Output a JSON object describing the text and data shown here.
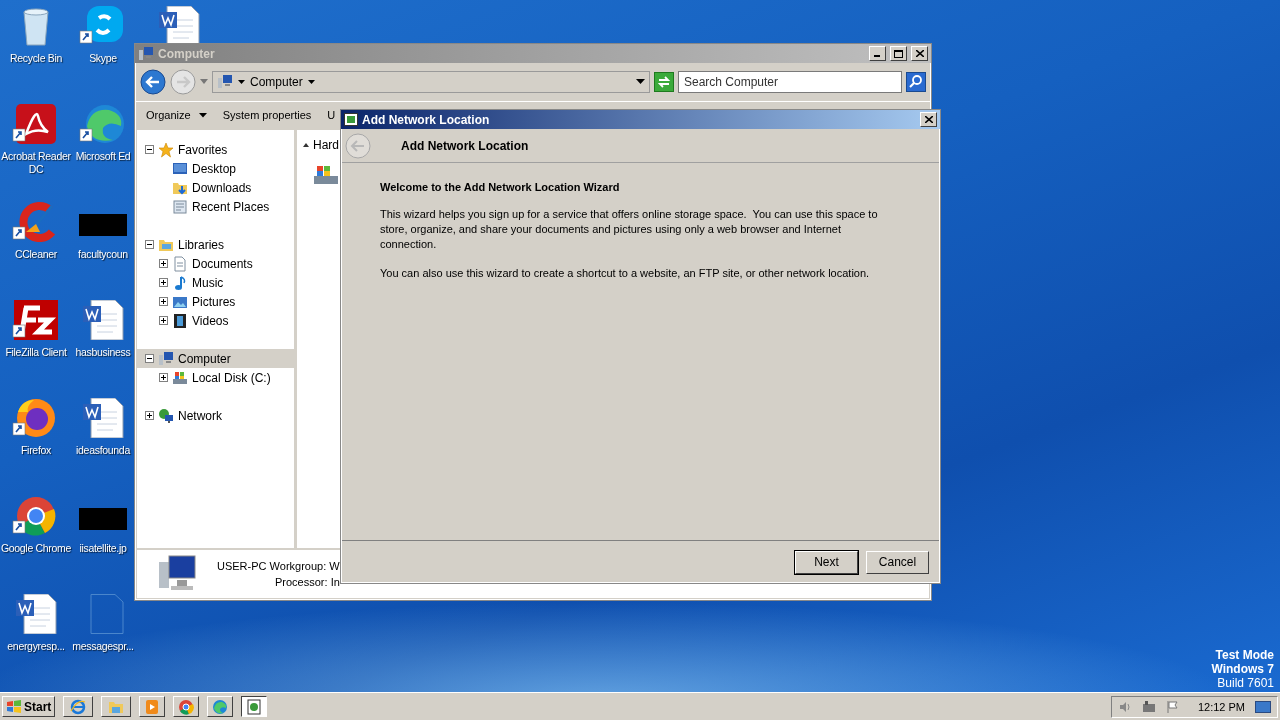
{
  "desktop_icons": [
    {
      "label": "Recycle Bin",
      "kind": "recycle",
      "shortcut": false
    },
    {
      "label": "Acrobat Reader DC",
      "kind": "pdf",
      "shortcut": true
    },
    {
      "label": "CCleaner",
      "kind": "ccleaner",
      "shortcut": true
    },
    {
      "label": "FileZilla Client",
      "kind": "filezilla",
      "shortcut": true
    },
    {
      "label": "Firefox",
      "kind": "firefox",
      "shortcut": true
    },
    {
      "label": "Google Chrome",
      "kind": "chrome",
      "shortcut": true
    },
    {
      "label": "energyresp...",
      "kind": "word",
      "shortcut": false
    },
    {
      "label": "Skype",
      "kind": "skype",
      "shortcut": true
    },
    {
      "label": "Microsoft Ed",
      "kind": "edge",
      "shortcut": true
    },
    {
      "label": "facultycoun",
      "kind": "thumbnail",
      "shortcut": false
    },
    {
      "label": "hasbusiness",
      "kind": "word",
      "shortcut": false
    },
    {
      "label": "ideasfounda",
      "kind": "word",
      "shortcut": false
    },
    {
      "label": "iisatellite.jp",
      "kind": "thumbnail",
      "shortcut": false
    },
    {
      "label": "messagespr...",
      "kind": "blank",
      "shortcut": false
    },
    {
      "kind": "word",
      "shortcut": false
    }
  ],
  "explorer": {
    "title": "Computer",
    "address": "Computer",
    "search": {
      "placeholder": "Search Computer"
    },
    "toolbar": [
      {
        "label": "Organize",
        "kind": "menu"
      },
      {
        "label": "System properties",
        "kind": "plain"
      },
      {
        "label": "U",
        "kind": "plain"
      }
    ],
    "nav_tree": [
      {
        "label": "Favorites",
        "kind": "star",
        "expanded": true,
        "selected": false,
        "children": [
          {
            "label": "Desktop",
            "kind": "desktop",
            "selected": false
          },
          {
            "label": "Downloads",
            "kind": "downloads",
            "selected": false
          },
          {
            "label": "Recent Places",
            "kind": "recent",
            "selected": false
          }
        ]
      },
      {
        "label": "Libraries",
        "kind": "libraries",
        "expanded": true,
        "selected": false,
        "children": [
          {
            "label": "Documents",
            "kind": "documents",
            "expanded": false,
            "selected": false
          },
          {
            "label": "Music",
            "kind": "music",
            "expanded": false,
            "selected": false
          },
          {
            "label": "Pictures",
            "kind": "pictures",
            "expanded": false,
            "selected": false
          },
          {
            "label": "Videos",
            "kind": "videos",
            "expanded": false,
            "selected": false
          }
        ]
      },
      {
        "label": "Computer",
        "kind": "computer",
        "expanded": true,
        "selected": true,
        "children": [
          {
            "label": "Local Disk (C:)",
            "kind": "disk",
            "expanded": false,
            "selected": false
          }
        ]
      },
      {
        "label": "Network",
        "kind": "network",
        "expanded": false,
        "selected": false
      }
    ],
    "group_header": "Hard",
    "details": {
      "name": "USER-PC",
      "workgroup": "Workgroup: W",
      "processor": "Processor: In"
    }
  },
  "dialog": {
    "title": "Add Network Location",
    "header": "Add Network Location",
    "heading": "Welcome to the Add Network Location Wizard",
    "paragraphs": [
      "This wizard helps you sign up for a service that offers online storage space.  You can use this space to store, organize, and share your documents and pictures using only a web browser and Internet connection.",
      "You can also use this wizard to create a shortcut to a website, an FTP site, or other network location."
    ],
    "buttons": [
      {
        "label": "Next",
        "default": true
      },
      {
        "label": "Cancel",
        "default": false
      }
    ]
  },
  "os_notice": [
    "Test Mode",
    "Windows 7",
    "Build 7601"
  ],
  "taskbar": {
    "start": "Start",
    "buttons": [
      {
        "kind": "ie",
        "selected": false
      },
      {
        "kind": "folder",
        "selected": false
      },
      {
        "kind": "media",
        "selected": false
      },
      {
        "kind": "chrome",
        "selected": false
      },
      {
        "kind": "edge",
        "selected": false
      },
      {
        "kind": "app",
        "selected": true
      }
    ],
    "clock": "12:12 PM"
  }
}
